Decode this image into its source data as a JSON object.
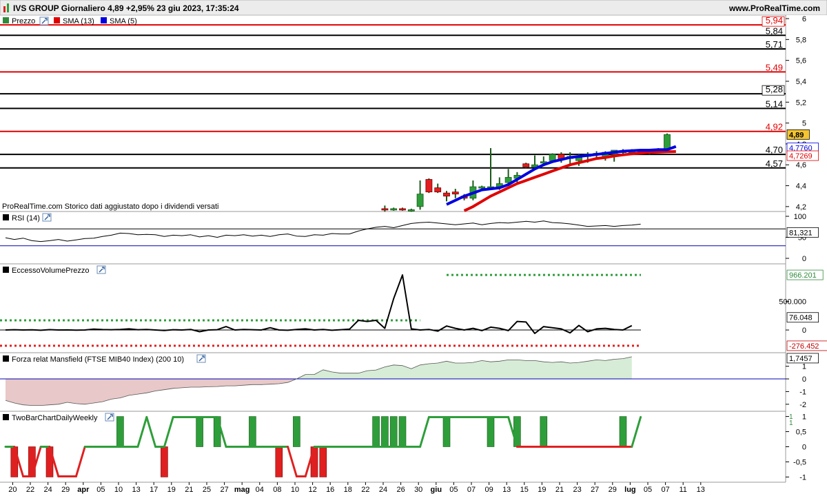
{
  "header": {
    "logo_icon": "bar-chart-icon",
    "title": "IVS GROUP Giornaliero 4,89 +2,95% 23 giu 2023, 17:35:24",
    "site": "www.ProRealTime.com"
  },
  "panels": {
    "price": {
      "legend": [
        {
          "label": "Prezzo",
          "color": "#2e8b3a",
          "icon": "wrench-icon"
        },
        {
          "label": "SMA (13)",
          "color": "#e00000"
        },
        {
          "label": "SMA (5)",
          "color": "#0000e0"
        }
      ],
      "watermark": "ProRealTime.com  Storico dati aggiustato dopo i dividendi versati"
    },
    "rsi": {
      "label": "RSI (14)",
      "icon": "wrench-icon"
    },
    "eccesso": {
      "label": "EccessoVolumePrezzo",
      "icon": "wrench-icon"
    },
    "mansfield": {
      "label": "Forza relat Mansfield (FTSE MIB40 Index) (200 10)",
      "icon": "wrench-icon"
    },
    "twobar": {
      "label": "TwoBarChartDailyWeekly",
      "icon": "wrench-icon"
    }
  },
  "colors": {
    "up": "#2e9e3a",
    "down": "#e02020",
    "sma13": "#e00000",
    "sma5": "#0000e0",
    "badge": "#f4c430"
  },
  "chart_data": [
    {
      "type": "candlestick",
      "name": "price",
      "ylim": [
        4.12,
        6.02
      ],
      "yticks": [
        "6",
        "5,8",
        "5,6",
        "5,4",
        "5,2",
        "5",
        "4,8",
        "4,6",
        "4,4",
        "4,2"
      ],
      "yticks_values": [
        6,
        5.8,
        5.6,
        5.4,
        5.2,
        5.0,
        4.8,
        4.6,
        4.4,
        4.2
      ],
      "hlines": [
        {
          "value": 5.94,
          "label": "5,94",
          "color": "#e00000",
          "boxed": true
        },
        {
          "value": 5.84,
          "label": "5,84",
          "color": "#000000"
        },
        {
          "value": 5.71,
          "label": "5,71",
          "color": "#000000"
        },
        {
          "value": 5.49,
          "label": "5,49",
          "color": "#e00000"
        },
        {
          "value": 5.28,
          "label": "5,28",
          "color": "#000000",
          "boxed": true
        },
        {
          "value": 5.14,
          "label": "5,14",
          "color": "#000000"
        },
        {
          "value": 4.92,
          "label": "4,92",
          "color": "#e00000"
        },
        {
          "value": 4.7,
          "label": "4,70",
          "color": "#000000"
        },
        {
          "value": 4.57,
          "label": "4,57",
          "color": "#000000"
        }
      ],
      "last_price": {
        "value": 4.89,
        "label": "4,89"
      },
      "sma5_last": {
        "value": 4.776,
        "label": "4,7760"
      },
      "sma13_last": {
        "value": 4.7269,
        "label": "4,7269"
      },
      "candles_start_index": 43,
      "candles": [
        {
          "o": 4.18,
          "h": 4.21,
          "l": 4.15,
          "c": 4.17
        },
        {
          "o": 4.17,
          "h": 4.19,
          "l": 4.16,
          "c": 4.18
        },
        {
          "o": 4.18,
          "h": 4.19,
          "l": 4.16,
          "c": 4.17
        },
        {
          "o": 4.17,
          "h": 4.18,
          "l": 4.15,
          "c": 4.17
        },
        {
          "o": 4.2,
          "h": 4.45,
          "l": 4.17,
          "c": 4.32
        },
        {
          "o": 4.46,
          "h": 4.47,
          "l": 4.33,
          "c": 4.34
        },
        {
          "o": 4.38,
          "h": 4.42,
          "l": 4.33,
          "c": 4.34
        },
        {
          "o": 4.33,
          "h": 4.35,
          "l": 4.25,
          "c": 4.3
        },
        {
          "o": 4.34,
          "h": 4.37,
          "l": 4.28,
          "c": 4.32
        },
        {
          "o": 4.3,
          "h": 4.32,
          "l": 4.26,
          "c": 4.28
        },
        {
          "o": 4.28,
          "h": 4.45,
          "l": 4.26,
          "c": 4.39
        },
        {
          "o": 4.38,
          "h": 4.4,
          "l": 4.37,
          "c": 4.39
        },
        {
          "o": 4.38,
          "h": 4.76,
          "l": 4.37,
          "c": 4.39
        },
        {
          "o": 4.39,
          "h": 4.48,
          "l": 4.36,
          "c": 4.42
        },
        {
          "o": 4.43,
          "h": 4.56,
          "l": 4.4,
          "c": 4.48
        },
        {
          "o": 4.47,
          "h": 4.53,
          "l": 4.43,
          "c": 4.5
        },
        {
          "o": 4.61,
          "h": 4.62,
          "l": 4.57,
          "c": 4.58
        },
        {
          "o": 4.58,
          "h": 4.69,
          "l": 4.56,
          "c": 4.6
        },
        {
          "o": 4.63,
          "h": 4.68,
          "l": 4.6,
          "c": 4.63
        },
        {
          "o": 4.64,
          "h": 4.71,
          "l": 4.62,
          "c": 4.7
        },
        {
          "o": 4.7,
          "h": 4.72,
          "l": 4.62,
          "c": 4.65
        },
        {
          "o": 4.66,
          "h": 4.72,
          "l": 4.6,
          "c": 4.68
        },
        {
          "o": 4.64,
          "h": 4.7,
          "l": 4.59,
          "c": 4.67
        },
        {
          "o": 4.68,
          "h": 4.72,
          "l": 4.62,
          "c": 4.7
        },
        {
          "o": 4.7,
          "h": 4.73,
          "l": 4.65,
          "c": 4.71
        },
        {
          "o": 4.67,
          "h": 4.73,
          "l": 4.64,
          "c": 4.72
        },
        {
          "o": 4.7,
          "h": 4.74,
          "l": 4.63,
          "c": 4.74
        },
        {
          "o": 4.72,
          "h": 4.75,
          "l": 4.69,
          "c": 4.73
        },
        {
          "o": 4.73,
          "h": 4.75,
          "l": 4.7,
          "c": 4.73
        },
        {
          "o": 4.73,
          "h": 4.75,
          "l": 4.71,
          "c": 4.74
        },
        {
          "o": 4.73,
          "h": 4.74,
          "l": 4.7,
          "c": 4.72
        },
        {
          "o": 4.73,
          "h": 4.76,
          "l": 4.72,
          "c": 4.75
        },
        {
          "o": 4.75,
          "h": 4.9,
          "l": 4.74,
          "c": 4.89
        }
      ],
      "sma5": {
        "start_index": 50,
        "values": [
          4.22,
          4.26,
          4.3,
          4.33,
          4.36,
          4.37,
          4.38,
          4.41,
          4.46,
          4.51,
          4.56,
          4.6,
          4.63,
          4.65,
          4.67,
          4.68,
          4.69,
          4.7,
          4.71,
          4.72,
          4.73,
          4.735,
          4.74,
          4.74,
          4.745,
          4.745,
          4.776
        ]
      },
      "sma13": {
        "start_index": 52,
        "values": [
          4.16,
          4.2,
          4.25,
          4.3,
          4.34,
          4.38,
          4.42,
          4.45,
          4.48,
          4.51,
          4.54,
          4.57,
          4.6,
          4.62,
          4.64,
          4.66,
          4.67,
          4.685,
          4.695,
          4.705,
          4.712,
          4.72,
          4.722,
          4.725,
          4.7269
        ]
      }
    },
    {
      "type": "line",
      "name": "rsi",
      "ylim": [
        0,
        100
      ],
      "yticks": [
        "100",
        "50",
        "0"
      ],
      "yticks_values": [
        100,
        50,
        0
      ],
      "hlines": [
        {
          "value": 70,
          "color": "#000000"
        },
        {
          "value": 30,
          "color": "#0000b0"
        }
      ],
      "last": {
        "value": 81.321,
        "label": "81,321"
      },
      "values": [
        49,
        45,
        48,
        42,
        40,
        42,
        45,
        41,
        44,
        47,
        48,
        52,
        55,
        60,
        59,
        56,
        57,
        56,
        52,
        55,
        54,
        56,
        51,
        54,
        50,
        55,
        54,
        56,
        53,
        55,
        52,
        56,
        58,
        53,
        52,
        56,
        55,
        59,
        58,
        58,
        65,
        70,
        74,
        76,
        73,
        78,
        83,
        85,
        86,
        84,
        82,
        80,
        82,
        84,
        80,
        83,
        85,
        84,
        86,
        88,
        86,
        89,
        85,
        84,
        82,
        79,
        76,
        77,
        78,
        76,
        78,
        79,
        81.321
      ]
    },
    {
      "type": "line",
      "name": "eccesso_volume_prezzo",
      "ylim": [
        -350000,
        1100000
      ],
      "yticks": [
        "500.000",
        "0"
      ],
      "yticks_values": [
        500000,
        0
      ],
      "upper_band": {
        "value": 966201,
        "label": "966.201",
        "start_index": 50
      },
      "lower_band": {
        "value": -276452,
        "label": "-276.452"
      },
      "prior_band": {
        "value": 170000,
        "end_index": 47
      },
      "last": {
        "value": 76048,
        "label": "76.048"
      },
      "values": [
        0,
        5000,
        0,
        3000,
        -5000,
        6000,
        0,
        2000,
        -3000,
        0,
        15000,
        8000,
        5000,
        10000,
        20000,
        5000,
        10000,
        0,
        -8000,
        5000,
        0,
        10000,
        -30000,
        0,
        5000,
        60000,
        0,
        10000,
        5000,
        0,
        40000,
        0,
        -5000,
        10000,
        20000,
        0,
        10000,
        -5000,
        5000,
        15000,
        170000,
        150000,
        170000,
        30000,
        550000,
        966201,
        20000,
        0,
        10000,
        -20000,
        70000,
        30000,
        0,
        30000,
        -10000,
        50000,
        30000,
        -10000,
        150000,
        140000,
        -60000,
        60000,
        40000,
        20000,
        -50000,
        80000,
        -30000,
        20000,
        30000,
        10000,
        0,
        76048
      ]
    },
    {
      "type": "area",
      "name": "mansfield",
      "ylim": [
        -2.5,
        1.85
      ],
      "yticks": [
        "1",
        "0",
        "-1",
        "-2"
      ],
      "yticks_values": [
        1,
        0,
        -1,
        -2
      ],
      "last": {
        "value": 1.7457,
        "label": "1,7457"
      },
      "values": [
        -1.7,
        -1.9,
        -2.05,
        -2.1,
        -2.1,
        -2.05,
        -2.0,
        -1.85,
        -1.95,
        -2.0,
        -1.9,
        -1.8,
        -1.6,
        -1.5,
        -1.3,
        -1.2,
        -1.1,
        -0.95,
        -0.85,
        -0.75,
        -0.7,
        -0.65,
        -0.65,
        -0.62,
        -0.6,
        -0.55,
        -0.55,
        -0.5,
        -0.45,
        -0.45,
        -0.42,
        -0.38,
        -0.28,
        0.0,
        0.35,
        0.35,
        0.72,
        0.55,
        0.45,
        0.45,
        0.45,
        0.65,
        0.7,
        0.95,
        1.1,
        1.05,
        0.8,
        1.1,
        1.2,
        1.25,
        1.4,
        1.25,
        1.25,
        1.3,
        1.45,
        1.35,
        1.4,
        1.5,
        1.5,
        1.45,
        1.45,
        1.35,
        1.3,
        1.35,
        1.25,
        1.3,
        1.4,
        1.5,
        1.45,
        1.55,
        1.6,
        1.7457
      ]
    },
    {
      "type": "bar",
      "name": "twobar",
      "ylim": [
        -1.15,
        1.15
      ],
      "yticks": [
        "1",
        "0,5",
        "0",
        "-0,5",
        "-1"
      ],
      "yticks_values": [
        1,
        0.5,
        0,
        -0.5,
        -1
      ],
      "last": {
        "values": [
          "1",
          "1"
        ]
      },
      "line": [
        0,
        0,
        -1,
        -1,
        0,
        0,
        -1,
        -1,
        -1,
        0,
        0,
        0,
        0,
        0,
        0,
        0,
        1,
        0,
        0,
        1,
        1,
        1,
        1,
        1,
        1,
        0,
        0,
        0,
        0,
        0,
        0,
        0,
        0,
        -1,
        -1,
        0,
        0,
        0,
        0,
        0,
        0,
        0,
        0,
        0,
        0,
        0,
        0,
        0,
        1,
        1,
        1,
        1,
        1,
        1,
        1,
        1,
        1,
        1,
        0,
        0,
        0,
        0,
        0,
        0,
        0,
        0,
        0,
        0,
        0,
        0,
        0,
        0,
        1
      ],
      "bars": [
        {
          "i": 1,
          "v": -1
        },
        {
          "i": 3,
          "v": -1
        },
        {
          "i": 5,
          "v": -1
        },
        {
          "i": 13,
          "v": 1
        },
        {
          "i": 18,
          "v": -1
        },
        {
          "i": 22,
          "v": 1
        },
        {
          "i": 24,
          "v": 1
        },
        {
          "i": 28,
          "v": 1
        },
        {
          "i": 31,
          "v": -1
        },
        {
          "i": 33,
          "v": 1
        },
        {
          "i": 35,
          "v": -1
        },
        {
          "i": 36,
          "v": -1
        },
        {
          "i": 42,
          "v": 1
        },
        {
          "i": 43,
          "v": 1
        },
        {
          "i": 44,
          "v": 1
        },
        {
          "i": 45,
          "v": 1
        },
        {
          "i": 50,
          "v": 1
        },
        {
          "i": 55,
          "v": 1
        },
        {
          "i": 58,
          "v": 1
        },
        {
          "i": 61,
          "v": 1
        },
        {
          "i": 70,
          "v": 1
        }
      ]
    }
  ],
  "x_axis": {
    "labels": [
      {
        "label": "20",
        "i": 0.5
      },
      {
        "label": "22",
        "i": 2.5
      },
      {
        "label": "24",
        "i": 4.5
      },
      {
        "label": "29",
        "i": 6.5
      },
      {
        "label": "apr",
        "i": 8.5,
        "bold": true
      },
      {
        "label": "05",
        "i": 10.5
      },
      {
        "label": "10",
        "i": 12.5
      },
      {
        "label": "13",
        "i": 14.5
      },
      {
        "label": "17",
        "i": 16.5
      },
      {
        "label": "19",
        "i": 18.5
      },
      {
        "label": "21",
        "i": 20.5
      },
      {
        "label": "25",
        "i": 22.5
      },
      {
        "label": "27",
        "i": 24.5
      },
      {
        "label": "mag",
        "i": 26.5,
        "bold": true
      },
      {
        "label": "04",
        "i": 28.5
      },
      {
        "label": "08",
        "i": 30.5
      },
      {
        "label": "10",
        "i": 32.5
      },
      {
        "label": "12",
        "i": 34.5
      },
      {
        "label": "16",
        "i": 36.5
      },
      {
        "label": "18",
        "i": 38.5
      },
      {
        "label": "22",
        "i": 40.5
      },
      {
        "label": "24",
        "i": 42.5
      },
      {
        "label": "26",
        "i": 44.5
      },
      {
        "label": "30",
        "i": 46.5
      },
      {
        "label": "giu",
        "i": 48.5,
        "bold": true
      },
      {
        "label": "05",
        "i": 50.5
      },
      {
        "label": "07",
        "i": 52.5
      },
      {
        "label": "09",
        "i": 54.5
      },
      {
        "label": "13",
        "i": 56.5
      },
      {
        "label": "15",
        "i": 58.5
      },
      {
        "label": "19",
        "i": 60.5
      },
      {
        "label": "21",
        "i": 62.5
      },
      {
        "label": "23",
        "i": 64.5
      },
      {
        "label": "27",
        "i": 66.5
      },
      {
        "label": "29",
        "i": 68.5
      },
      {
        "label": "lug",
        "i": 70.5,
        "bold": true
      },
      {
        "label": "05",
        "i": 72.5
      },
      {
        "label": "07",
        "i": 74.5
      },
      {
        "label": "11",
        "i": 76.5
      },
      {
        "label": "13",
        "i": 78.5
      }
    ]
  }
}
